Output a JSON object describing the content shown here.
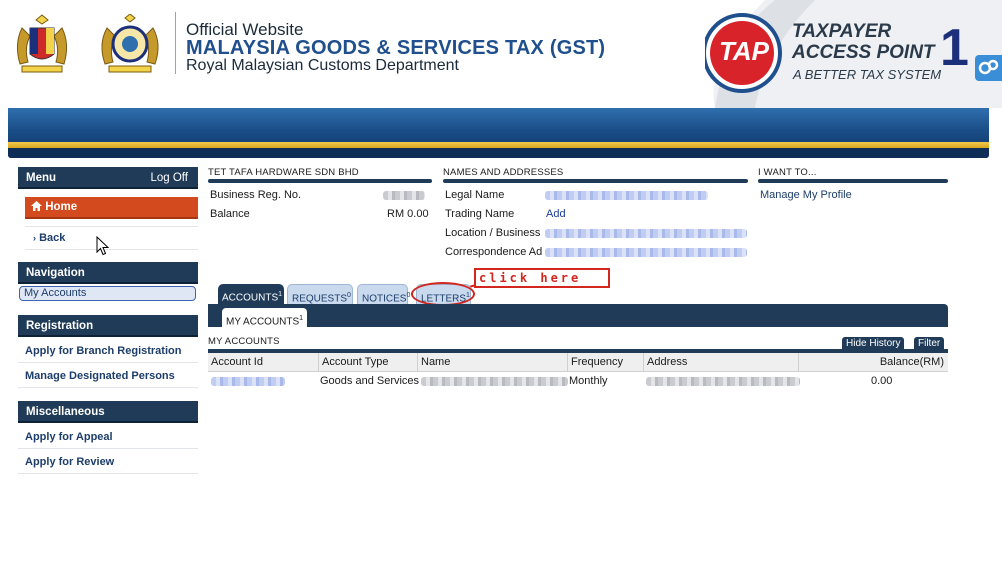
{
  "header": {
    "line1": "Official Website",
    "line2": "MALAYSIA GOODS & SERVICES TAX (GST)",
    "line3": "Royal Malaysian Customs Department",
    "tap_logo_text": "TAP",
    "tap_title_1": "TAXPAYER",
    "tap_title_2": "ACCESS POINT",
    "tap_subtitle": "A BETTER TAX SYSTEM",
    "badge_number": "1"
  },
  "sidebar": {
    "menu_title": "Menu",
    "logoff": "Log Off",
    "home": "Home",
    "back": "Back",
    "navigation_title": "Navigation",
    "my_accounts": "My Accounts",
    "registration_title": "Registration",
    "registration_items": [
      "Apply for Branch Registration",
      "Manage Designated Persons"
    ],
    "misc_title": "Miscellaneous",
    "misc_items": [
      "Apply for Appeal",
      "Apply for Review"
    ]
  },
  "company": {
    "name": "TET TAFA HARDWARE SDN BHD",
    "reg_label": "Business Reg. No.",
    "balance_label": "Balance",
    "balance_value": "RM 0.00"
  },
  "names": {
    "title": "NAMES AND ADDRESSES",
    "legal_name": "Legal Name",
    "trading_name": "Trading Name",
    "trading_value": "Add",
    "location": "Location / Business",
    "correspondence": "Correspondence Ad"
  },
  "iwant": {
    "title": "I WANT TO...",
    "manage_profile": "Manage My Profile"
  },
  "tabs": [
    {
      "label": "ACCOUNTS",
      "count": "1"
    },
    {
      "label": "REQUESTS",
      "count": "0"
    },
    {
      "label": "NOTICES",
      "count": "0"
    },
    {
      "label": "LETTERS",
      "count": "1"
    }
  ],
  "subtab": {
    "label": "MY ACCOUNTS",
    "count": "1"
  },
  "annotation": "click here",
  "accounts": {
    "title": "MY ACCOUNTS",
    "hide_history": "Hide History",
    "filter": "Filter",
    "columns": [
      "Account Id",
      "Account Type",
      "Name",
      "Frequency",
      "Address",
      "Balance(RM)"
    ],
    "row": {
      "account_type": "Goods and Services",
      "frequency": "Monthly",
      "balance": "0.00"
    }
  },
  "colors": {
    "navy": "#1f3b57",
    "home_red": "#d24a1e",
    "annotation_red": "#d2261f"
  }
}
